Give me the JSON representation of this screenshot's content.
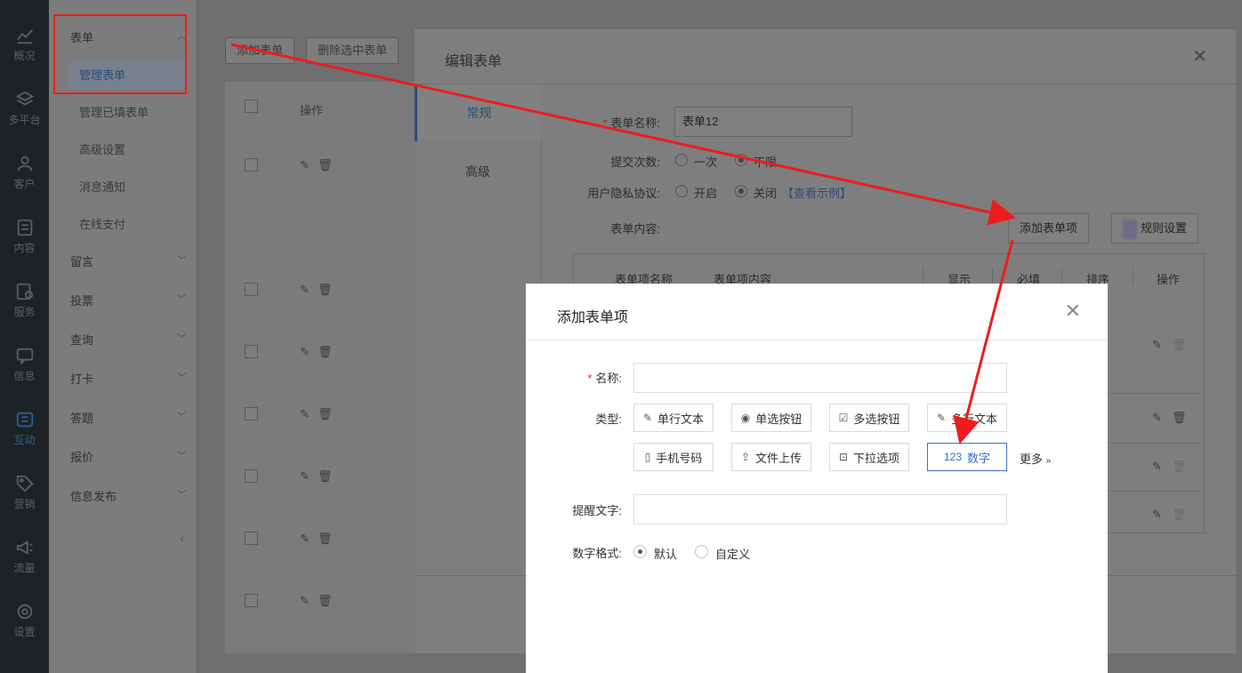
{
  "rail": {
    "items": [
      {
        "label": "概况",
        "icon": "chart-icon"
      },
      {
        "label": "多平台",
        "icon": "layers-icon"
      },
      {
        "label": "客户",
        "icon": "user-icon"
      },
      {
        "label": "内容",
        "icon": "document-icon"
      },
      {
        "label": "服务",
        "icon": "service-icon"
      },
      {
        "label": "信息",
        "icon": "message-icon"
      },
      {
        "label": "互动",
        "icon": "interaction-icon"
      },
      {
        "label": "营销",
        "icon": "tag-icon"
      },
      {
        "label": "流量",
        "icon": "megaphone-icon"
      },
      {
        "label": "设置",
        "icon": "gear-icon"
      }
    ],
    "active": "互动"
  },
  "menu": {
    "form_group": "表单",
    "form_items": [
      "管理表单",
      "管理已填表单",
      "高级设置",
      "消息通知",
      "在线支付"
    ],
    "active_item": "管理表单",
    "groups": [
      "留言",
      "投票",
      "查询",
      "打卡",
      "答题",
      "报价",
      "信息发布"
    ]
  },
  "list": {
    "add_button": "添加表单",
    "delete_button": "删除选中表单",
    "operation_header": "操作"
  },
  "edit_dialog": {
    "title": "编辑表单",
    "tabs": [
      "常规",
      "高级"
    ],
    "active_tab": "常规",
    "form_name_label": "表单名称:",
    "form_name_value": "表单12",
    "submit_count_label": "提交次数:",
    "submit_options": [
      "一次",
      "不限"
    ],
    "submit_selected": "不限",
    "privacy_label": "用户隐私协议:",
    "privacy_options": [
      "开启",
      "关闭"
    ],
    "privacy_selected": "关闭",
    "privacy_link": "【查看示例】",
    "content_label": "表单内容:",
    "add_item_button": "添加表单项",
    "rule_button": "规则设置",
    "table_headers": [
      "表单项名称",
      "表单项内容",
      "显示",
      "必填",
      "排序",
      "操作"
    ]
  },
  "add_dialog": {
    "title": "添加表单项",
    "name_label": "名称:",
    "type_label": "类型:",
    "types": [
      {
        "label": "单行文本",
        "icon": "edit-icon"
      },
      {
        "label": "单选按钮",
        "icon": "radio-icon"
      },
      {
        "label": "多选按钮",
        "icon": "checkbox-icon"
      },
      {
        "label": "多行文本",
        "icon": "multiline-edit-icon"
      },
      {
        "label": "手机号码",
        "icon": "phone-icon"
      },
      {
        "label": "文件上传",
        "icon": "upload-icon"
      },
      {
        "label": "下拉选项",
        "icon": "dropdown-icon"
      },
      {
        "label": "数字",
        "icon": "number-icon",
        "prefix": "123"
      }
    ],
    "selected_type": "数字",
    "more_label": "更多",
    "hint_label": "提醒文字:",
    "number_format_label": "数字格式:",
    "number_format_options": [
      "默认",
      "自定义"
    ],
    "number_format_selected": "默认"
  },
  "colors": {
    "accent": "#3a6fc7",
    "annotation": "#ee1c1c",
    "required": "#e0302f"
  }
}
